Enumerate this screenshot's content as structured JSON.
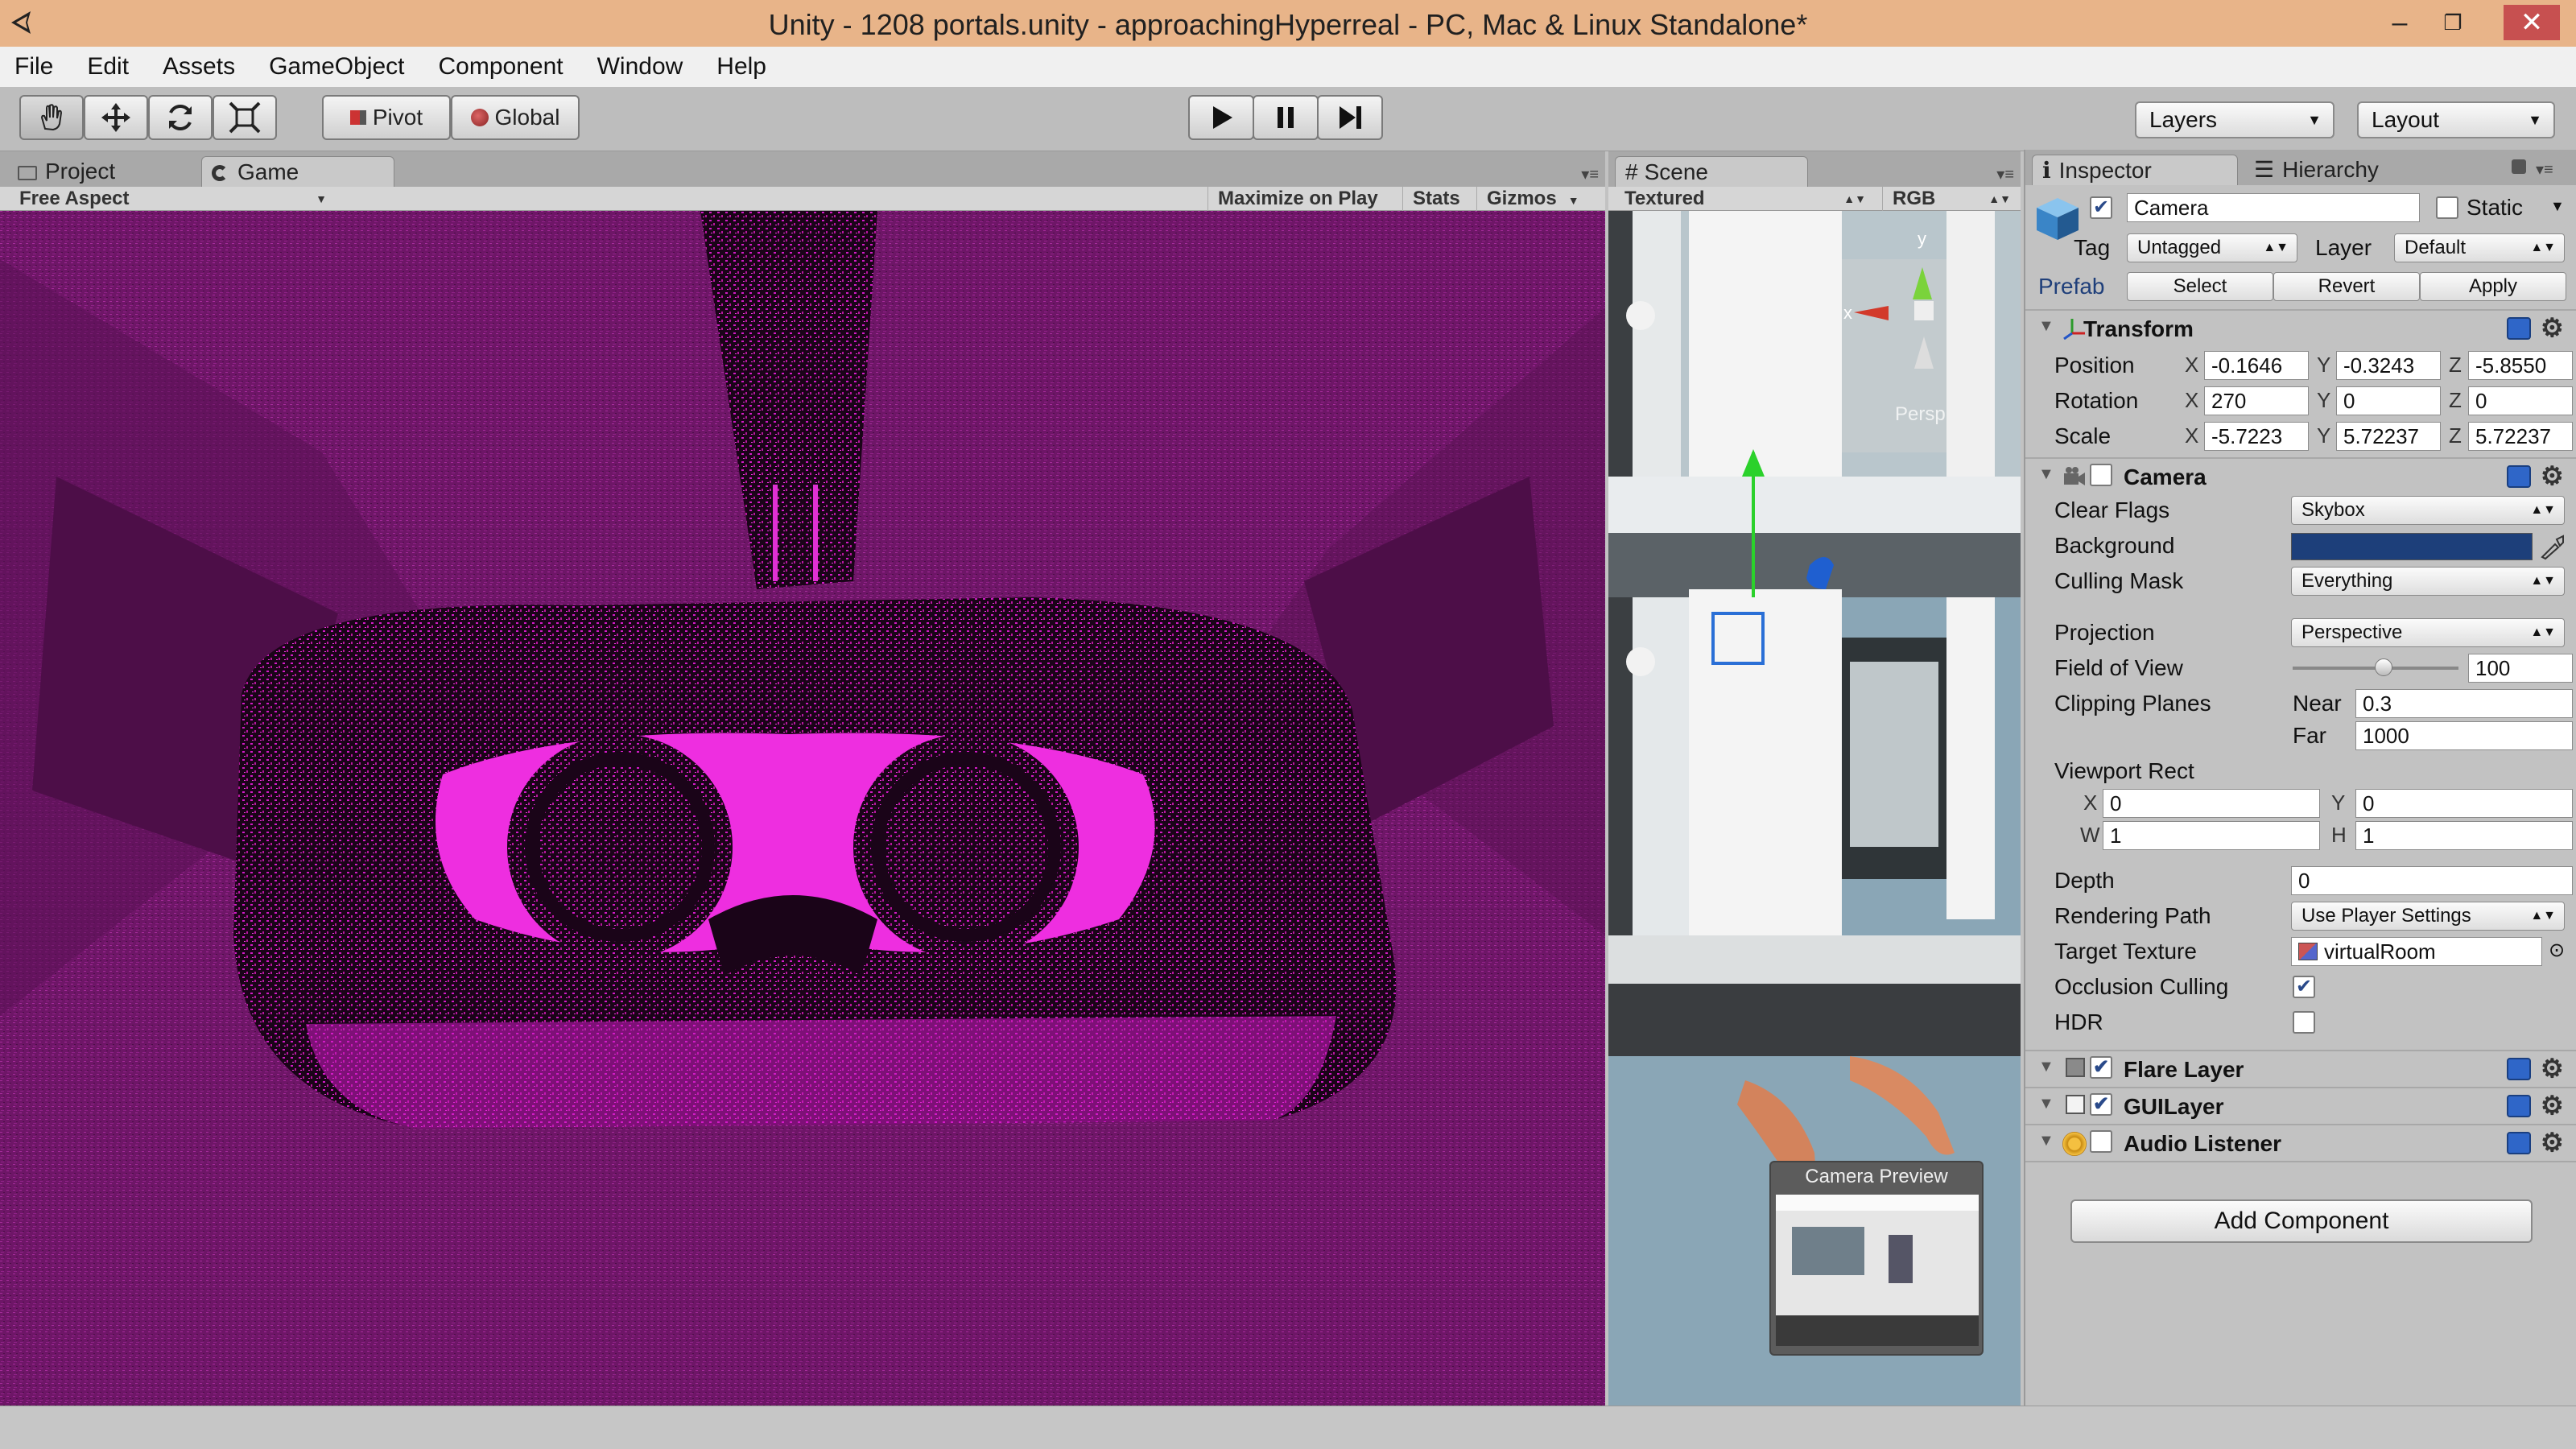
{
  "window": {
    "title": "Unity - 1208 portals.unity - approachingHyperreal - PC, Mac & Linux Standalone*",
    "controls": [
      "–",
      "❐",
      "✕"
    ]
  },
  "menu": [
    "File",
    "Edit",
    "Assets",
    "GameObject",
    "Component",
    "Window",
    "Help"
  ],
  "toolbar": {
    "pivot_label": "Pivot",
    "global_label": "Global",
    "layers_label": "Layers",
    "layout_label": "Layout"
  },
  "game_panel": {
    "tabs": [
      "Project",
      "Game"
    ],
    "aspect": "Free Aspect",
    "maximize": "Maximize on Play",
    "stats": "Stats",
    "gizmos": "Gizmos"
  },
  "scene_panel": {
    "tab": "Scene",
    "render_mode": "Textured",
    "channel": "RGB",
    "persp_label": "Persp",
    "preview_title": "Camera Preview",
    "gizmo_y": "y",
    "gizmo_x": "x"
  },
  "inspector": {
    "tabs": [
      "Inspector",
      "Hierarchy"
    ],
    "object_name": "Camera",
    "static_label": "Static",
    "tag_label": "Tag",
    "tag_value": "Untagged",
    "layer_label": "Layer",
    "layer_value": "Default",
    "prefab_label": "Prefab",
    "prefab_buttons": [
      "Select",
      "Revert",
      "Apply"
    ],
    "transform": {
      "title": "Transform",
      "position_label": "Position",
      "rotation_label": "Rotation",
      "scale_label": "Scale",
      "position": [
        "-0.1646",
        "-0.3243",
        "-5.8550"
      ],
      "rotation": [
        "270",
        "0",
        "0"
      ],
      "scale": [
        "-5.7223",
        "5.72237",
        "5.72237"
      ]
    },
    "camera": {
      "title": "Camera",
      "clear_flags_label": "Clear Flags",
      "clear_flags": "Skybox",
      "background_label": "Background",
      "background_color": "#1d3f7a",
      "culling_mask_label": "Culling Mask",
      "culling_mask": "Everything",
      "projection_label": "Projection",
      "projection": "Perspective",
      "fov_label": "Field of View",
      "fov": "100",
      "fov_slider_fraction": 0.55,
      "clipping_label": "Clipping Planes",
      "near_label": "Near",
      "near": "0.3",
      "far_label": "Far",
      "far": "1000",
      "viewport_label": "Viewport Rect",
      "vp_x": "0",
      "vp_y": "0",
      "vp_w": "1",
      "vp_h": "1",
      "depth_label": "Depth",
      "depth": "0",
      "rendering_path_label": "Rendering Path",
      "rendering_path": "Use Player Settings",
      "target_texture_label": "Target Texture",
      "target_texture": "virtualRoom",
      "occlusion_label": "Occlusion Culling",
      "hdr_label": "HDR"
    },
    "components": [
      "Flare Layer",
      "GUILayer",
      "Audio Listener"
    ],
    "add_component": "Add Component",
    "axes": {
      "x": "X",
      "y": "Y",
      "z": "Z",
      "w": "W",
      "h": "H"
    }
  }
}
